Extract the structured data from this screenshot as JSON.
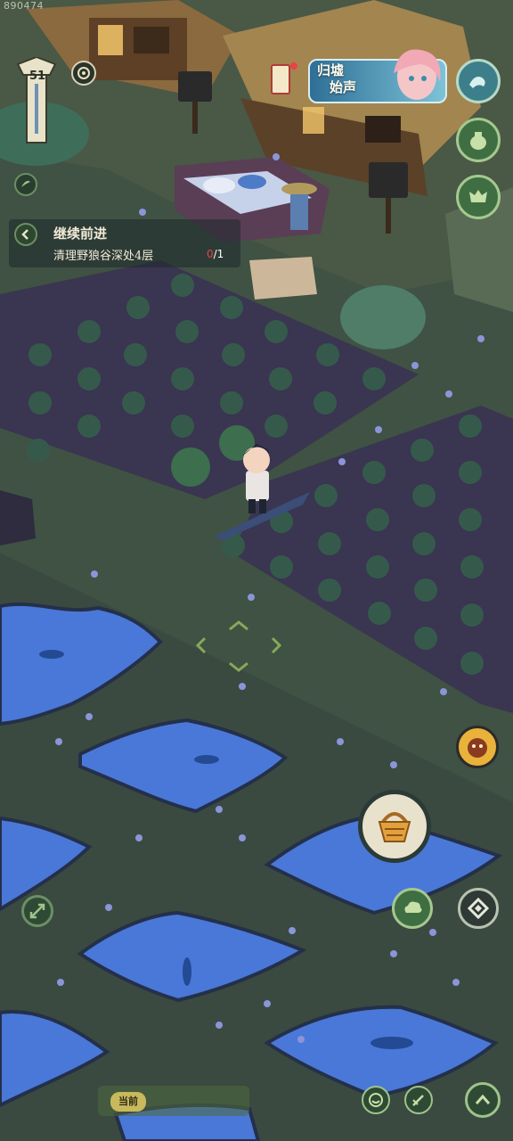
{
  "status": {
    "uid": "890474"
  },
  "player": {
    "level": "51"
  },
  "quest": {
    "title": "继续前进",
    "description": "清理野狼谷深处4层",
    "progress_current": "0",
    "progress_total": "/1"
  },
  "event_banner": {
    "line1": "归墟",
    "line2": "始声"
  },
  "map": {
    "current_location_tag": "当前"
  },
  "colors": {
    "water": "#4a78d8",
    "field": "#3a3550",
    "grass": "#3f5244",
    "accent": "#c9b85c",
    "progress_red": "#e8434a"
  },
  "icons": {
    "compass": "compass-icon",
    "wave": "wave-skill-icon",
    "jar": "jar-icon",
    "monster": "monster-mask-icon",
    "basket": "basket-icon",
    "cloud": "cloud-skill-icon",
    "diamond": "diamond-skill-icon",
    "expand": "expand-arrows-icon",
    "emote": "emote-face-icon",
    "pen": "brush-icon",
    "up": "chevron-up-icon",
    "back": "chevron-left-icon"
  }
}
